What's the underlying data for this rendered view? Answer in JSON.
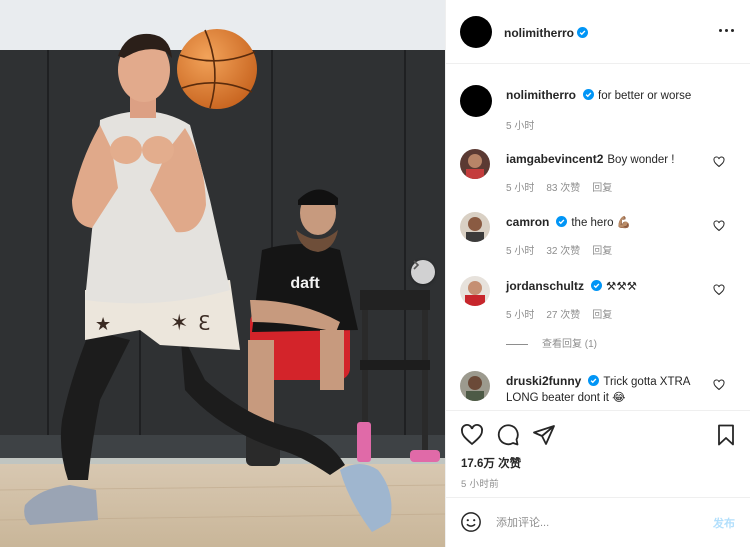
{
  "post": {
    "author": "nolimitherro",
    "caption": {
      "username": "nolimitherro",
      "text": "for better or worse",
      "time": "5 小时"
    }
  },
  "comments": [
    {
      "username": "iamgabevincent2",
      "text": "Boy wonder !",
      "time": "5 小时",
      "likes": "83 次赞",
      "reply": "回复"
    },
    {
      "username": "camron",
      "text": "the hero 💪🏽",
      "time": "5 小时",
      "likes": "32 次赞",
      "reply": "回复"
    },
    {
      "username": "jordanschultz",
      "text": "⚒⚒⚒",
      "time": "5 小时",
      "likes": "27 次赞",
      "reply": "回复"
    },
    {
      "username": "druski2funny",
      "text": "Trick gotta XTRA LONG beater dont it 😂",
      "time": "",
      "likes": "",
      "reply": ""
    }
  ],
  "view_replies": "查看回复 (1)",
  "actions": {
    "likes_count": "17.6万 次赞",
    "timestamp": "5 小时前"
  },
  "add_comment": {
    "placeholder": "添加评论...",
    "post_label": "发布"
  },
  "photo": {
    "shirt_text": "daft"
  },
  "colors": {
    "verified": "#0095f6",
    "post_button_disabled": "#b2dffc",
    "secondary_text": "#8e8e8e"
  },
  "icons": [
    "more-options-icon",
    "verified-icon",
    "heart-icon",
    "comment-icon",
    "share-icon",
    "save-icon",
    "emoji-icon",
    "carousel-next-icon"
  ]
}
